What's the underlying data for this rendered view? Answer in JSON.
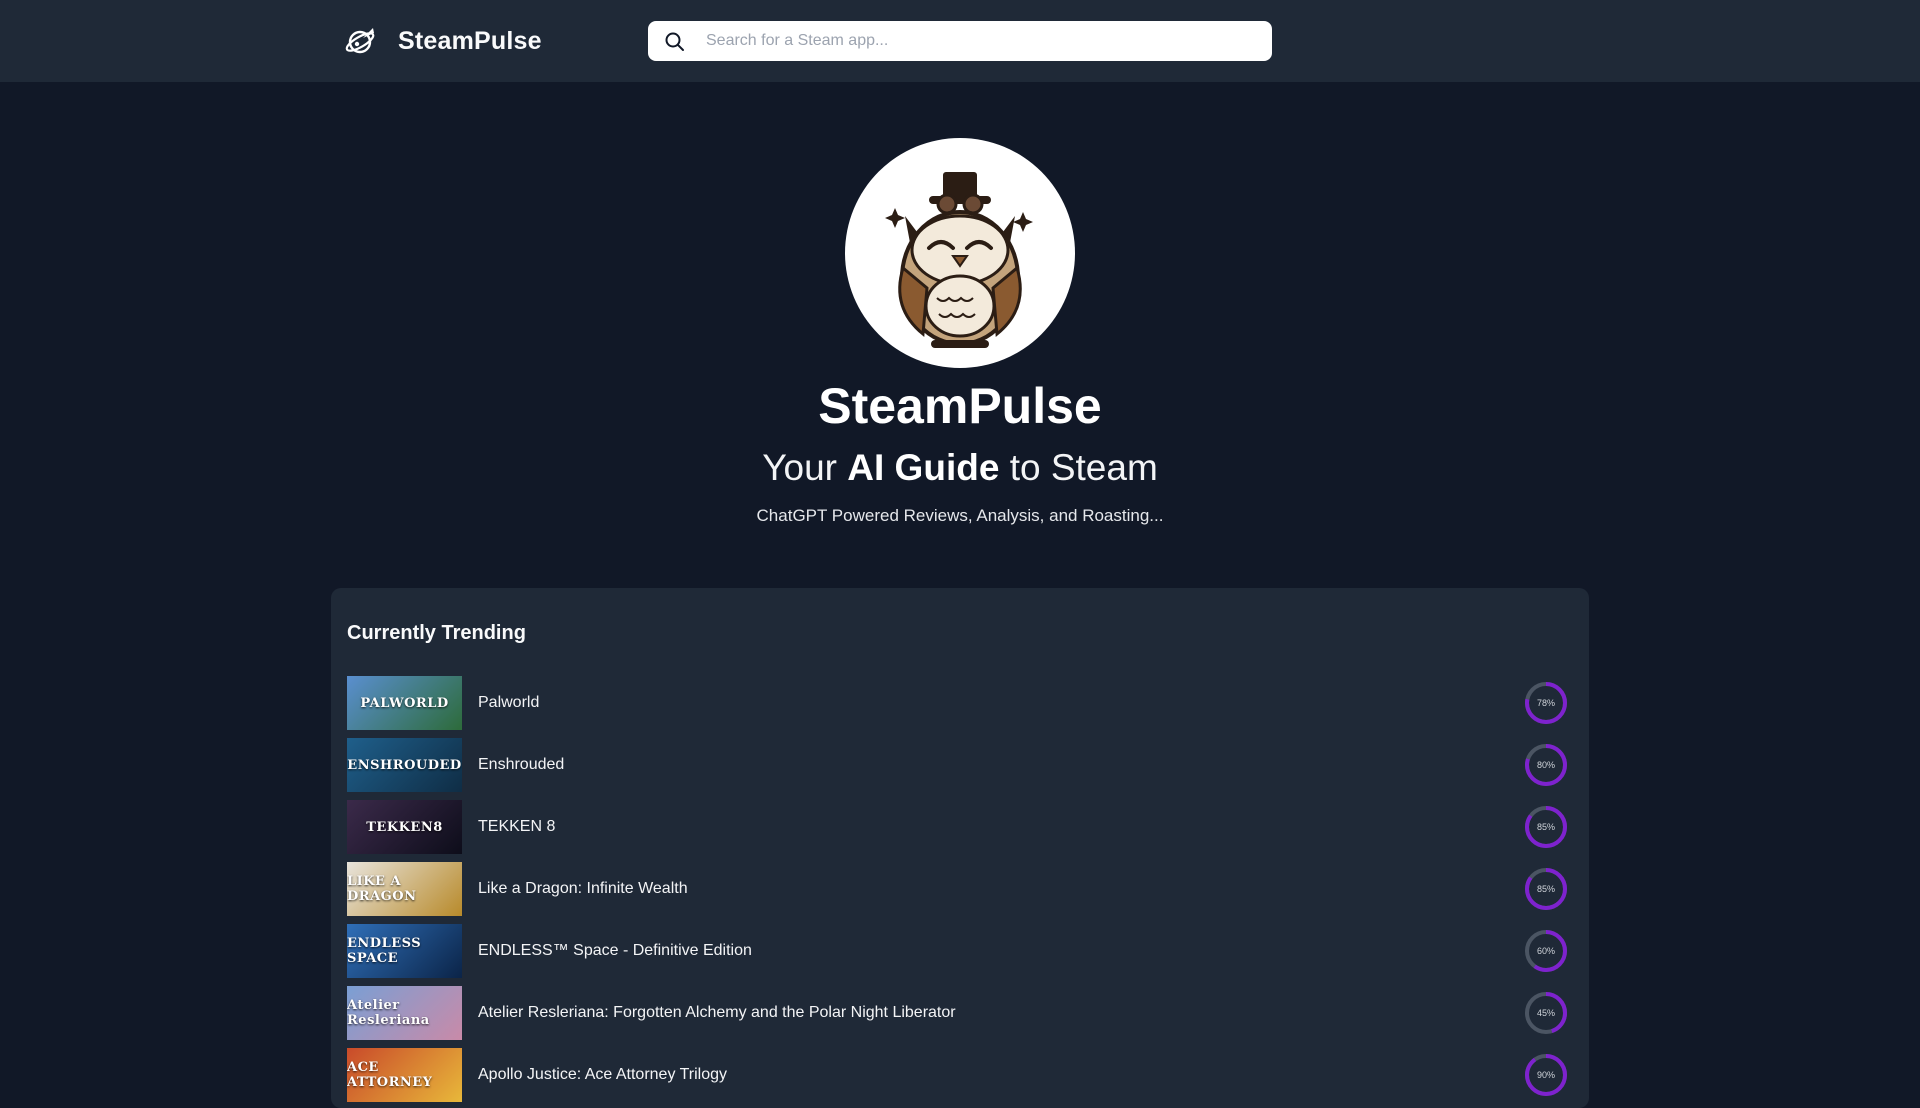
{
  "header": {
    "brand_name": "SteamPulse",
    "brand_icon": "rocket-planet-icon",
    "search_placeholder": "Search for a Steam app...",
    "search_icon": "search-icon"
  },
  "hero": {
    "mascot": "owl-mascot-logo",
    "title": "SteamPulse",
    "tagline_pre": "Your",
    "tagline_bold": "AI Guide",
    "tagline_post": "to Steam",
    "subtitle": "ChatGPT Powered Reviews, Analysis, and Roasting..."
  },
  "colors": {
    "page_bg": "#111827",
    "panel_bg": "#1f2937",
    "score_ring": "#7e22ce",
    "score_track": "#4b5563"
  },
  "trending": {
    "title": "Currently Trending",
    "items": [
      {
        "name": "Palworld",
        "score_label": "78%",
        "score": 78,
        "thumb_text": "PALWORLD",
        "thumb_colors": [
          "#5a8fd0",
          "#2d6b3a"
        ]
      },
      {
        "name": "Enshrouded",
        "score_label": "80%",
        "score": 80,
        "thumb_text": "ENSHROUDED",
        "thumb_colors": [
          "#1f5f8b",
          "#0f2d45"
        ]
      },
      {
        "name": "TEKKEN 8",
        "score_label": "85%",
        "score": 85,
        "thumb_text": "TEKKEN8",
        "thumb_colors": [
          "#3b2a4a",
          "#0d0d1a"
        ]
      },
      {
        "name": "Like a Dragon: Infinite Wealth",
        "score_label": "85%",
        "score": 85,
        "thumb_text": "LIKE A DRAGON",
        "thumb_colors": [
          "#e8e4dc",
          "#b88a2a"
        ]
      },
      {
        "name": "ENDLESS™ Space - Definitive Edition",
        "score_label": "60%",
        "score": 60,
        "thumb_text": "ENDLESS SPACE",
        "thumb_colors": [
          "#2f6fb8",
          "#0b2448"
        ]
      },
      {
        "name": "Atelier Resleriana: Forgotten Alchemy and the Polar Night Liberator",
        "score_label": "45%",
        "score": 45,
        "thumb_text": "Atelier Resleriana",
        "thumb_colors": [
          "#7a9fd4",
          "#c98aa8"
        ]
      },
      {
        "name": "Apollo Justice: Ace Attorney Trilogy",
        "score_label": "90%",
        "score": 90,
        "thumb_text": "ACE ATTORNEY",
        "thumb_colors": [
          "#c94a2a",
          "#e8b83a"
        ]
      }
    ]
  }
}
